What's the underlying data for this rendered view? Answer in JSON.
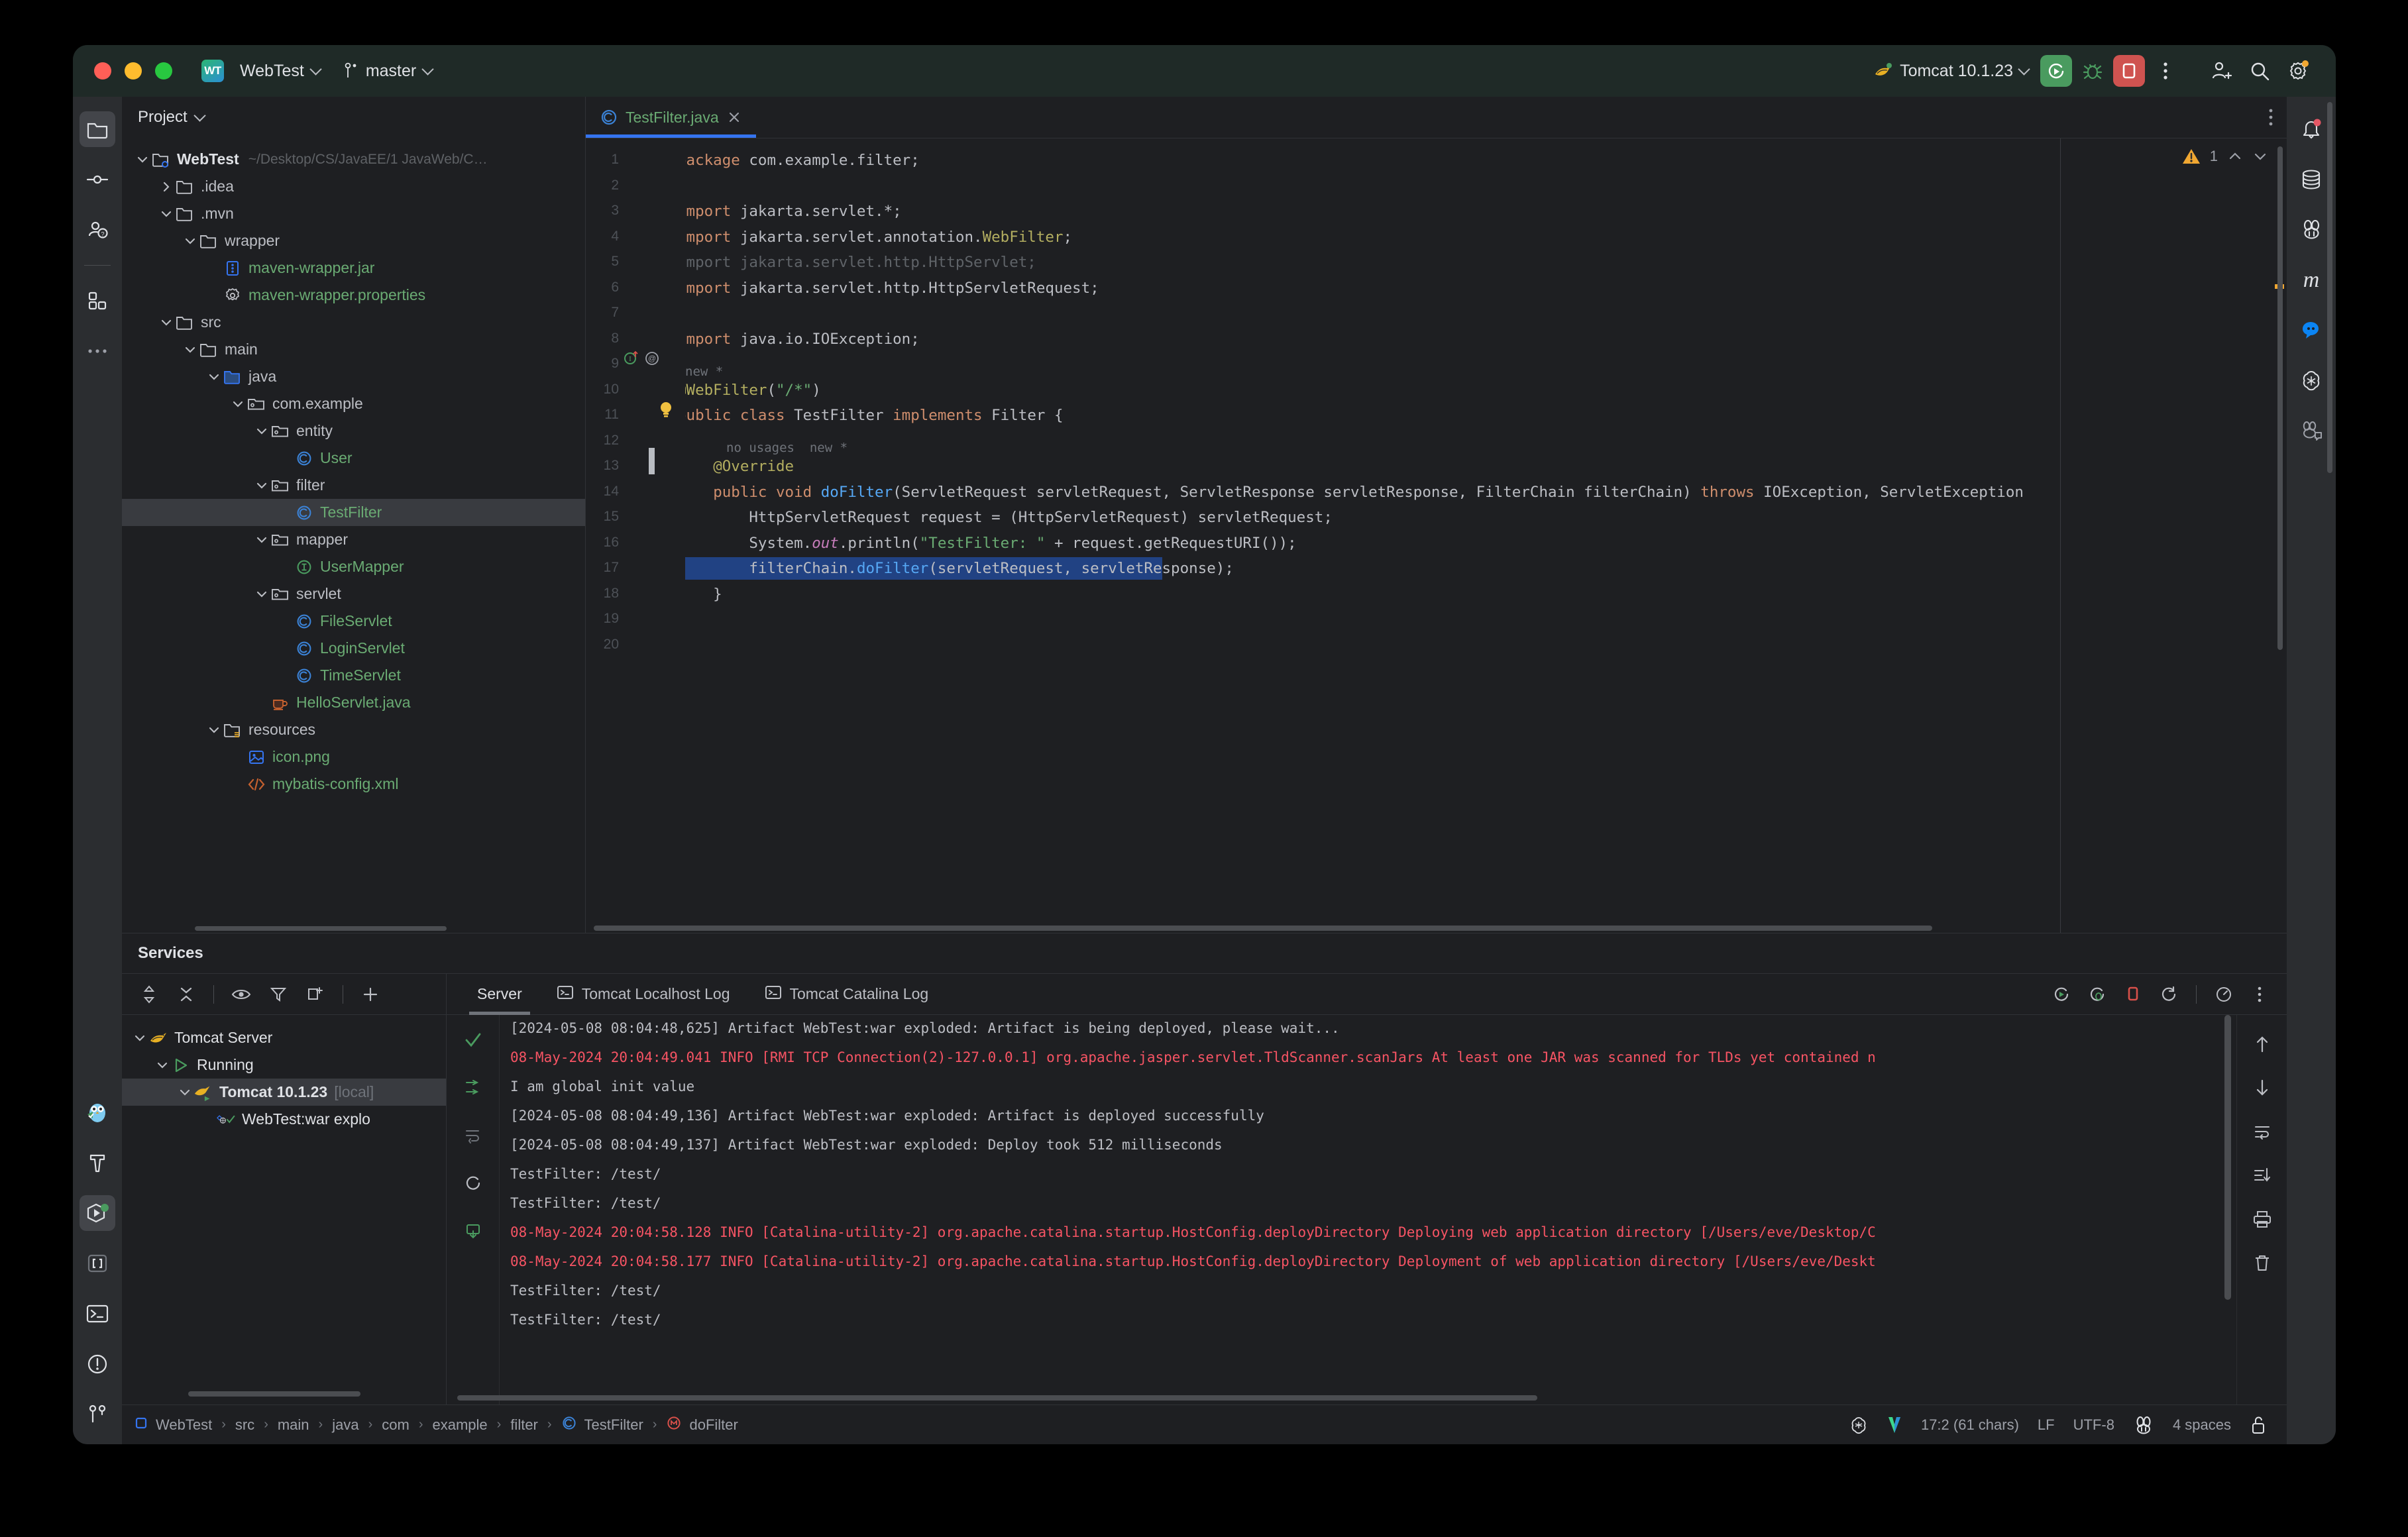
{
  "titlebar": {
    "project_badge": "WT",
    "project_name": "WebTest",
    "branch": "master",
    "run_config": "Tomcat 10.1.23",
    "icons": {
      "cat": "tomcat-icon",
      "rerun": "rerun-icon",
      "debug": "debug-icon",
      "stop": "stop-icon",
      "more": "more-vertical-icon",
      "add_user": "add-user-icon",
      "search": "search-icon",
      "settings": "settings-gear-icon"
    }
  },
  "left_rail": [
    {
      "name": "sidebar-item-project",
      "icon": "folder-icon",
      "active": true
    },
    {
      "name": "sidebar-item-commit",
      "icon": "commit-icon",
      "active": false
    },
    {
      "name": "sidebar-item-pull-requests",
      "icon": "pull-request-icon",
      "active": false
    },
    {
      "name": "sidebar-item-structure",
      "icon": "structure-blocks-icon",
      "active": false
    },
    {
      "name": "sidebar-item-more",
      "icon": "more-horizontal-icon",
      "active": false
    }
  ],
  "left_rail_bottom": [
    {
      "name": "sidebar-item-ai-owl",
      "icon": "owl-icon",
      "active": false
    },
    {
      "name": "sidebar-item-build",
      "icon": "hammer-icon",
      "active": false
    },
    {
      "name": "sidebar-item-services",
      "icon": "services-run-icon",
      "active": true
    },
    {
      "name": "sidebar-item-endpoints",
      "icon": "brackets-icon",
      "active": false
    },
    {
      "name": "sidebar-item-terminal",
      "icon": "terminal-icon",
      "active": false
    },
    {
      "name": "sidebar-item-problems",
      "icon": "problems-warning-icon",
      "active": false
    },
    {
      "name": "sidebar-item-git",
      "icon": "git-branch-icon",
      "active": false
    }
  ],
  "right_rail": [
    {
      "name": "sidebar-item-notifications",
      "icon": "bell-icon",
      "badge": true
    },
    {
      "name": "sidebar-item-database",
      "icon": "database-icon",
      "badge": false
    },
    {
      "name": "sidebar-item-rabbit-ai",
      "icon": "rabbit-icon",
      "badge": false
    },
    {
      "name": "sidebar-item-maven",
      "icon": "maven-m-icon",
      "badge": false
    },
    {
      "name": "sidebar-item-chat",
      "icon": "chat-bubble-icon",
      "badge": false
    },
    {
      "name": "sidebar-item-openai",
      "icon": "openai-icon",
      "badge": false
    },
    {
      "name": "sidebar-item-ai-assistant",
      "icon": "ai-assistant-icon",
      "badge": false
    }
  ],
  "project_panel": {
    "title": "Project",
    "tree": [
      {
        "depth": 0,
        "arrow": "down",
        "icon": "module-folder-icon",
        "label": "WebTest",
        "style": "bold",
        "path": "~/Desktop/CS/JavaEE/1 JavaWeb/C…"
      },
      {
        "depth": 1,
        "arrow": "right",
        "icon": "folder-icon",
        "label": ".idea",
        "style": "plain"
      },
      {
        "depth": 1,
        "arrow": "down",
        "icon": "folder-icon",
        "label": ".mvn",
        "style": "plain"
      },
      {
        "depth": 2,
        "arrow": "down",
        "icon": "folder-icon",
        "label": "wrapper",
        "style": "plain"
      },
      {
        "depth": 3,
        "arrow": "none",
        "icon": "jar-icon",
        "label": "maven-wrapper.jar",
        "style": "green"
      },
      {
        "depth": 3,
        "arrow": "none",
        "icon": "properties-icon",
        "label": "maven-wrapper.properties",
        "style": "green"
      },
      {
        "depth": 1,
        "arrow": "down",
        "icon": "folder-icon",
        "label": "src",
        "style": "plain"
      },
      {
        "depth": 2,
        "arrow": "down",
        "icon": "folder-icon",
        "label": "main",
        "style": "plain"
      },
      {
        "depth": 3,
        "arrow": "down",
        "icon": "source-folder-icon",
        "label": "java",
        "style": "plain"
      },
      {
        "depth": 4,
        "arrow": "down",
        "icon": "package-icon",
        "label": "com.example",
        "style": "plain"
      },
      {
        "depth": 5,
        "arrow": "down",
        "icon": "package-icon",
        "label": "entity",
        "style": "plain"
      },
      {
        "depth": 6,
        "arrow": "none",
        "icon": "class-icon",
        "label": "User",
        "style": "green"
      },
      {
        "depth": 5,
        "arrow": "down",
        "icon": "package-icon",
        "label": "filter",
        "style": "plain"
      },
      {
        "depth": 6,
        "arrow": "none",
        "icon": "class-icon",
        "label": "TestFilter",
        "style": "green",
        "selected": true
      },
      {
        "depth": 5,
        "arrow": "down",
        "icon": "package-icon",
        "label": "mapper",
        "style": "plain"
      },
      {
        "depth": 6,
        "arrow": "none",
        "icon": "interface-icon",
        "label": "UserMapper",
        "style": "green"
      },
      {
        "depth": 5,
        "arrow": "down",
        "icon": "package-icon",
        "label": "servlet",
        "style": "plain"
      },
      {
        "depth": 6,
        "arrow": "none",
        "icon": "class-icon",
        "label": "FileServlet",
        "style": "green"
      },
      {
        "depth": 6,
        "arrow": "none",
        "icon": "class-icon",
        "label": "LoginServlet",
        "style": "green"
      },
      {
        "depth": 6,
        "arrow": "none",
        "icon": "class-icon",
        "label": "TimeServlet",
        "style": "green"
      },
      {
        "depth": 5,
        "arrow": "none",
        "icon": "java-file-icon",
        "label": "HelloServlet.java",
        "style": "green"
      },
      {
        "depth": 3,
        "arrow": "down",
        "icon": "resource-folder-icon",
        "label": "resources",
        "style": "plain"
      },
      {
        "depth": 4,
        "arrow": "none",
        "icon": "image-file-icon",
        "label": "icon.png",
        "style": "green"
      },
      {
        "depth": 4,
        "arrow": "none",
        "icon": "xml-file-icon",
        "label": "mybatis-config.xml",
        "style": "green"
      }
    ]
  },
  "editor": {
    "tab": {
      "label": "TestFilter.java",
      "icon": "class-icon",
      "close": "close-icon"
    },
    "inspection": {
      "warning_count": "1",
      "up": "chevron-up-icon",
      "down": "chevron-down-icon"
    },
    "more": "more-vertical-icon",
    "cursor_line": 17,
    "selected_line": 17,
    "lines": [
      {
        "n": 1,
        "text": "package com.example.filter;"
      },
      {
        "n": 2,
        "text": ""
      },
      {
        "n": 3,
        "text": "import jakarta.servlet.*;"
      },
      {
        "n": 4,
        "text": "import jakarta.servlet.annotation.WebFilter;"
      },
      {
        "n": 5,
        "text": "import jakarta.servlet.http.HttpServlet;"
      },
      {
        "n": 6,
        "text": "import jakarta.servlet.http.HttpServletRequest;"
      },
      {
        "n": 7,
        "text": ""
      },
      {
        "n": 8,
        "text": "import java.io.IOException;"
      },
      {
        "n": 9,
        "text": ""
      },
      {
        "n": 10,
        "text": "@WebFilter(\"/*\")"
      },
      {
        "n": 11,
        "text": "public class TestFilter implements Filter {"
      },
      {
        "n": 12,
        "text": ""
      },
      {
        "n": 13,
        "text": "    @Override"
      },
      {
        "n": 14,
        "text": "    public void doFilter(ServletRequest servletRequest, ServletResponse servletResponse, FilterChain filterChain) throws IOException, ServletException"
      },
      {
        "n": 15,
        "text": "        HttpServletRequest request = (HttpServletRequest) servletRequest;"
      },
      {
        "n": 16,
        "text": "        System.out.println(\"TestFilter: \" + request.getRequestURI());"
      },
      {
        "n": 17,
        "text": "        filterChain.doFilter(servletRequest, servletResponse);"
      },
      {
        "n": 18,
        "text": "    }"
      },
      {
        "n": 19,
        "text": ""
      },
      {
        "n": 20,
        "text": ""
      }
    ],
    "inlay_hints": [
      {
        "after_line": 9,
        "text": "new *"
      },
      {
        "after_line": 12,
        "text": "no usages  new *"
      }
    ]
  },
  "services": {
    "title": "Services",
    "toolbar": [
      {
        "name": "expand-collapse-icon"
      },
      {
        "name": "collapse-all-icon"
      },
      {
        "name": "show-hide-icon"
      },
      {
        "name": "filter-icon"
      },
      {
        "name": "open-in-new-window-icon"
      },
      {
        "name": "add-service-icon"
      }
    ],
    "tree": [
      {
        "depth": 0,
        "arrow": "down",
        "icon": "tomcat-icon",
        "label": "Tomcat Server",
        "style": "plain"
      },
      {
        "depth": 1,
        "arrow": "down",
        "icon": "run-play-icon",
        "label": "Running",
        "style": "plain"
      },
      {
        "depth": 2,
        "arrow": "down",
        "icon": "tomcat-running-icon",
        "label": "Tomcat 10.1.23",
        "suffix": "[local]",
        "style": "bold",
        "selected": true
      },
      {
        "depth": 3,
        "arrow": "none",
        "icon": "artifact-deployed-icon",
        "label": "WebTest:war explo",
        "style": "plain"
      }
    ]
  },
  "console": {
    "tabs": [
      {
        "label": "Server",
        "icon": "",
        "active": true
      },
      {
        "label": "Tomcat Localhost Log",
        "icon": "console-log-icon",
        "active": false
      },
      {
        "label": "Tomcat Catalina Log",
        "icon": "console-log-icon",
        "active": false
      }
    ],
    "tab_actions": [
      {
        "name": "rerun-icon"
      },
      {
        "name": "rerun-debug-icon"
      },
      {
        "name": "stop-icon"
      },
      {
        "name": "restart-icon"
      },
      {
        "name": "profiler-icon"
      },
      {
        "name": "more-vertical-icon"
      }
    ],
    "gutter_icons": [
      {
        "name": "success-check-icon"
      },
      {
        "name": "scroll-to-end-icon"
      },
      {
        "name": "soft-wrap-icon"
      },
      {
        "name": "rerun-circle-icon"
      },
      {
        "name": "export-icon"
      }
    ],
    "side_icons": [
      {
        "name": "up-arrow-icon"
      },
      {
        "name": "down-arrow-icon"
      },
      {
        "name": "soft-wrap-icon"
      },
      {
        "name": "scroll-to-end-icon"
      },
      {
        "name": "print-icon"
      },
      {
        "name": "trash-icon"
      }
    ],
    "lines": [
      {
        "text": "[2024-05-08 08:04:48,625] Artifact WebTest:war exploded: Artifact is being deployed, please wait...",
        "error": false
      },
      {
        "text": "08-May-2024 20:04:49.041 INFO [RMI TCP Connection(2)-127.0.0.1] org.apache.jasper.servlet.TldScanner.scanJars At least one JAR was scanned for TLDs yet contained n",
        "error": true
      },
      {
        "text": "I am global init value",
        "error": false
      },
      {
        "text": "[2024-05-08 08:04:49,136] Artifact WebTest:war exploded: Artifact is deployed successfully",
        "error": false
      },
      {
        "text": "[2024-05-08 08:04:49,137] Artifact WebTest:war exploded: Deploy took 512 milliseconds",
        "error": false
      },
      {
        "text": "TestFilter: /test/",
        "error": false
      },
      {
        "text": "TestFilter: /test/",
        "error": false
      },
      {
        "text": "08-May-2024 20:04:58.128 INFO [Catalina-utility-2] org.apache.catalina.startup.HostConfig.deployDirectory Deploying web application directory [/Users/eve/Desktop/C",
        "error": true
      },
      {
        "text": "08-May-2024 20:04:58.177 INFO [Catalina-utility-2] org.apache.catalina.startup.HostConfig.deployDirectory Deployment of web application directory [/Users/eve/Deskt",
        "error": true
      },
      {
        "text": "TestFilter: /test/",
        "error": false
      },
      {
        "text": "TestFilter: /test/",
        "error": false
      }
    ]
  },
  "statusbar": {
    "breadcrumbs": [
      "WebTest",
      "src",
      "main",
      "java",
      "com",
      "example",
      "filter",
      "TestFilter",
      "doFilter"
    ],
    "caret": "17:2 (61 chars)",
    "line_separator": "LF",
    "encoding": "UTF-8",
    "indent": "4 spaces",
    "icons": {
      "openai": "openai-icon",
      "plugin_v": "plugin-v-icon",
      "rabbit": "rabbit-icon",
      "lock": "unlocked-icon"
    }
  },
  "colors": {
    "accent_blue": "#3574f0",
    "selection_blue": "#214283",
    "green_text": "#6aab73",
    "error_red": "#f75464",
    "warn_orange": "#f0a732",
    "keyword_orange": "#cf8e6d",
    "string_green": "#6aab73",
    "annotation_yellow": "#b3ae60",
    "method_blue": "#56a8f5",
    "static_purple": "#c77dbb",
    "panel_bg": "#1e1f22",
    "rail_bg": "#2b2d30",
    "titlebar_bg": "#1f2a27"
  }
}
